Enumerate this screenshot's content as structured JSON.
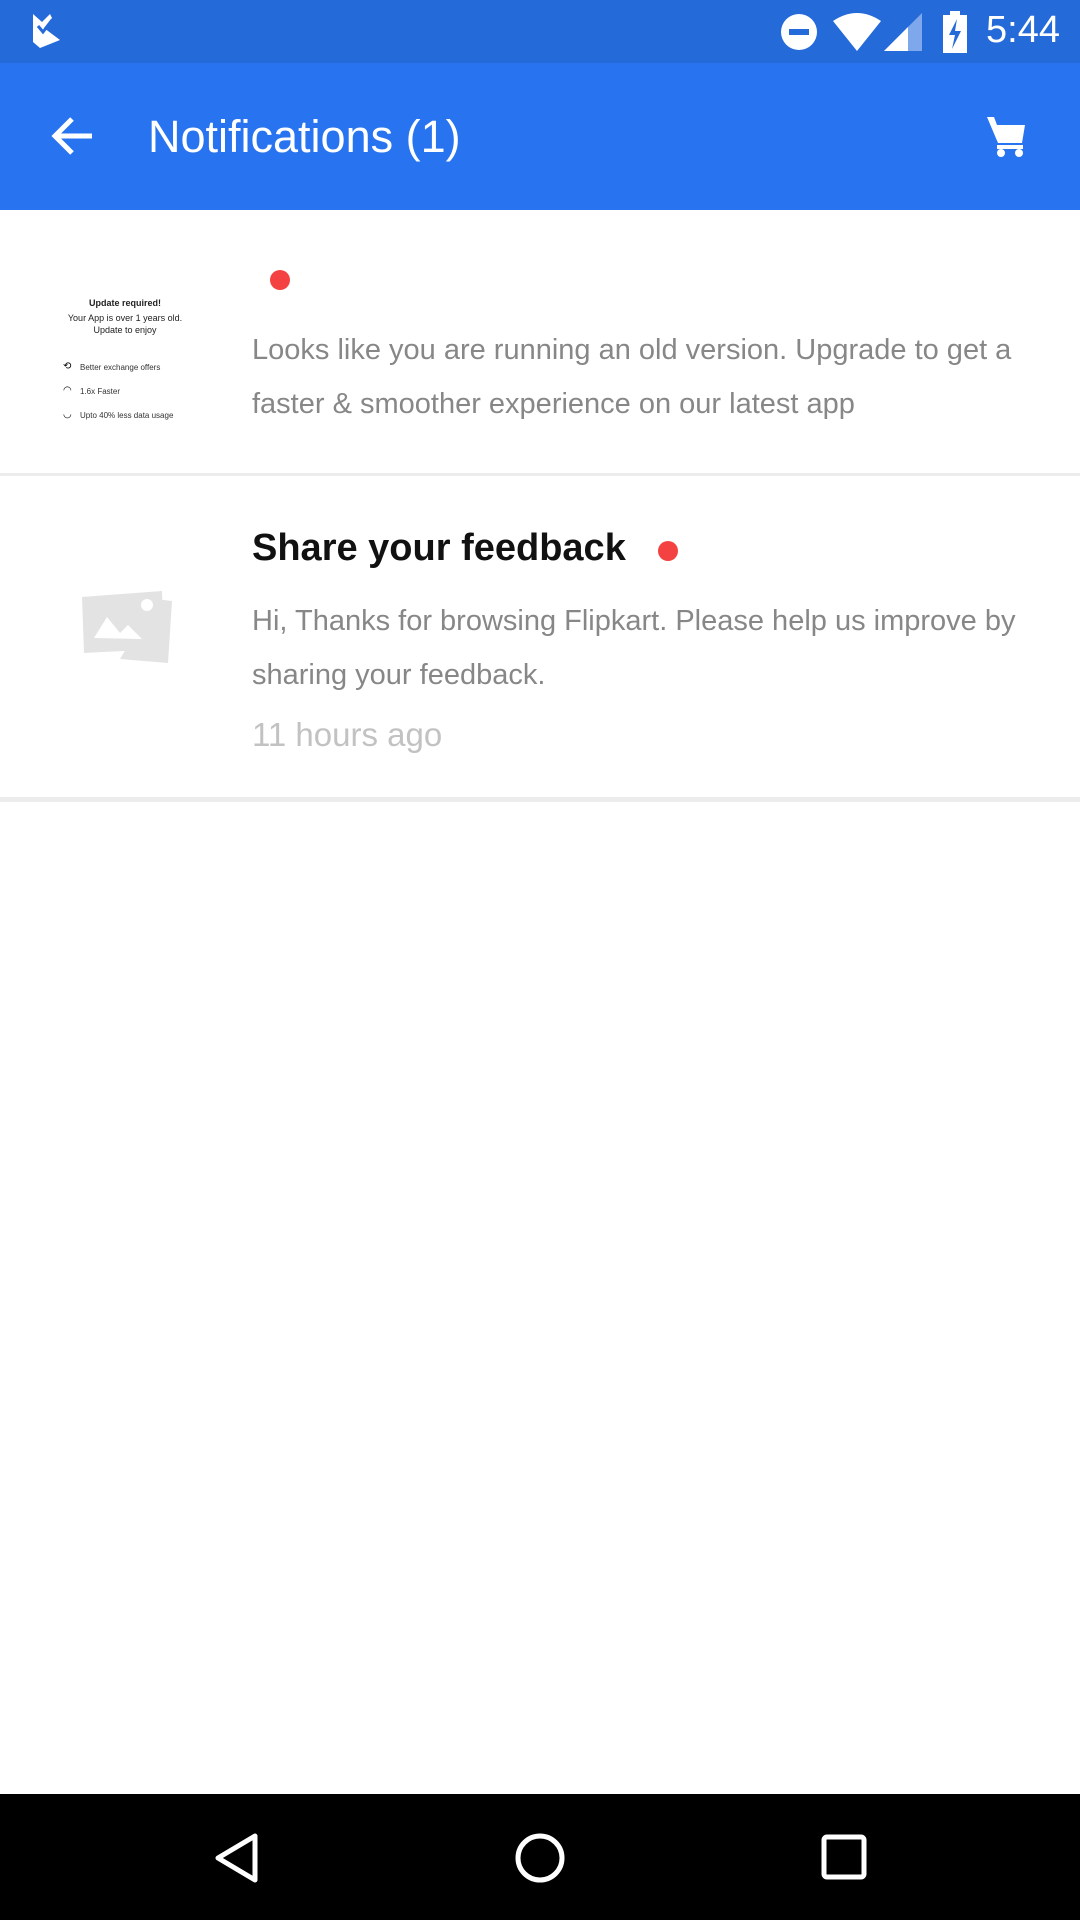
{
  "status_bar": {
    "time": "5:44",
    "icons": [
      "flipkart-check-icon",
      "do-not-disturb-icon",
      "wifi-icon",
      "signal-icon",
      "battery-charging-icon"
    ]
  },
  "app_bar": {
    "title": "Notifications (1)",
    "icons": [
      "back-arrow-icon",
      "cart-icon"
    ]
  },
  "notifications": [
    {
      "unread": true,
      "body": "Looks like you are running an old version. Upgrade to get a faster & smoother experience on our latest app",
      "thumbnail": {
        "heading": "Update required!",
        "line1": "Your App is over 1 years old.",
        "line2": "Update to enjoy",
        "features": [
          "Better exchange offers",
          "1.6x Faster",
          "Upto 40% less data usage"
        ]
      }
    },
    {
      "unread": true,
      "title": "Share your feedback",
      "body": "Hi, Thanks for browsing Flipkart. Please help us improve by sharing your feedback.",
      "time": "11 hours ago",
      "thumbnail_icon": "image-placeholder-icon"
    }
  ],
  "colors": {
    "status_bar": "#246bd9",
    "app_bar": "#2874f0",
    "unread_dot": "#f44242"
  }
}
